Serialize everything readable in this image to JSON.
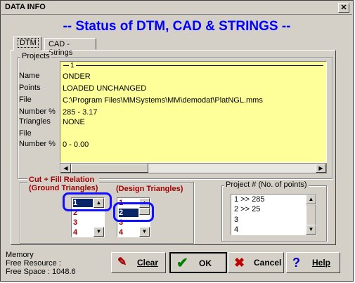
{
  "window": {
    "title": "DATA INFO",
    "close_label": "✕"
  },
  "heading": "--  Status of DTM, CAD & STRINGS  --",
  "tabs": [
    {
      "label": "DTM"
    },
    {
      "label": "CAD - Strings"
    }
  ],
  "projects": {
    "group_label": "Projects",
    "number_label": "1",
    "rows": [
      {
        "label": "Name",
        "value": "ONDER"
      },
      {
        "label": "Points",
        "value": "LOADED UNCHANGED"
      },
      {
        "label": "File",
        "value": "C:\\Program Files\\MMSystems\\MM\\demodat\\PlatNGL.mms"
      },
      {
        "label": "Number %",
        "value": "285 - 3.17"
      },
      {
        "label": "Triangles",
        "value": "NONE"
      },
      {
        "label": "File",
        "value": ""
      },
      {
        "label": "Number %",
        "value": "0 - 0.00"
      }
    ]
  },
  "cutfill": {
    "label_line1": "Cut + Fill Relation",
    "label_line2": "(Ground Triangles)",
    "design_label": "(Design Triangles)",
    "ground_items": [
      "1",
      "2",
      "3",
      "4"
    ],
    "design_items": [
      "1",
      "2",
      "3",
      "4"
    ],
    "ground_selected": "1",
    "design_selected": "2"
  },
  "project_points": {
    "label": "Project # (No. of points)",
    "items": [
      "1  >>  285",
      "2  >>  25",
      "3",
      "4"
    ]
  },
  "status": {
    "memory": "Memory",
    "free_resource": "Free Resource :",
    "free_space": "Free Space : 1048.6"
  },
  "buttons": {
    "clear": "Clear",
    "ok": "OK",
    "cancel": "Cancel",
    "help": "Help"
  },
  "icons": {
    "clear": "eraser-icon",
    "ok": "check-icon",
    "cancel": "x-icon",
    "help": "question-icon"
  }
}
